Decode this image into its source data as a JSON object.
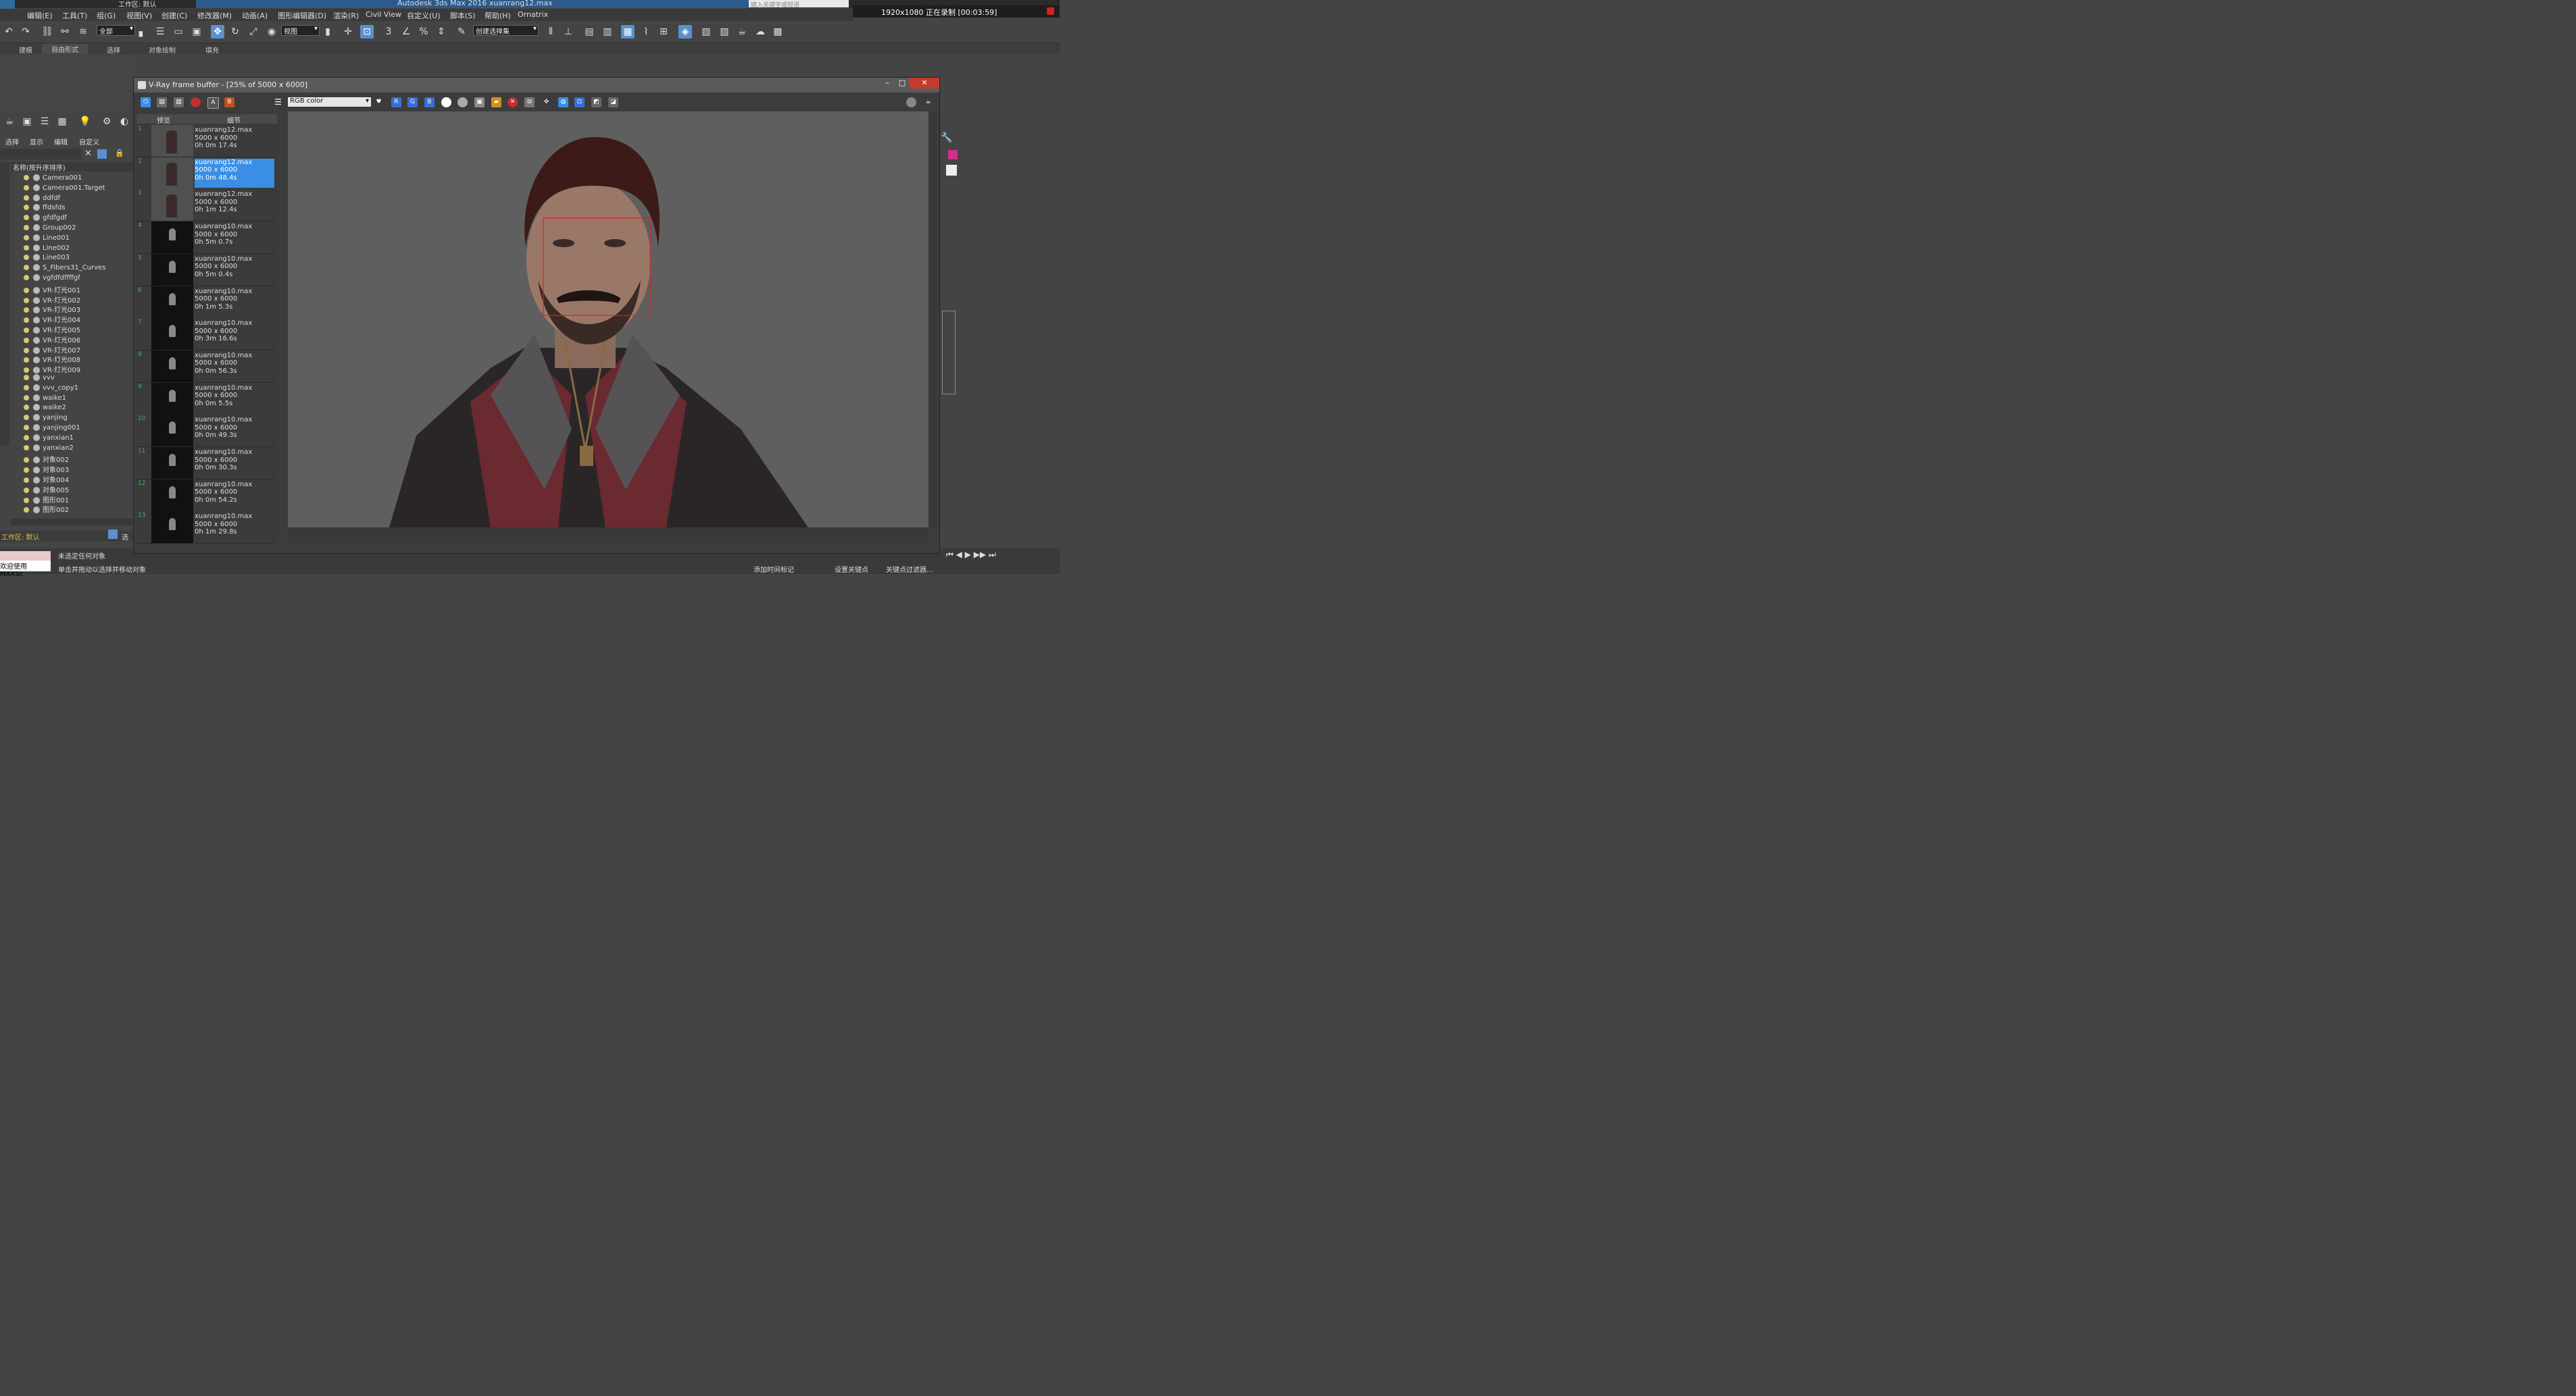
{
  "app": {
    "title": "Autodesk 3ds Max 2016    xuanrang12.max",
    "workspace": "工作区: 默认",
    "search_placeholder": "键入关键字或短语",
    "recording": "1920x1080  正在录制 [00:03:59]"
  },
  "menu": [
    "编辑(E)",
    "工具(T)",
    "组(G)",
    "视图(V)",
    "创建(C)",
    "修改器(M)",
    "动画(A)",
    "图形编辑器(D)",
    "渲染(R)",
    "Civil View",
    "自定义(U)",
    "脚本(S)",
    "帮助(H)",
    "Ornatrix"
  ],
  "toolbar": {
    "selection_filter": "全部",
    "ref_coord": "视图",
    "named_set": "创建选择集"
  },
  "ribbon_tabs": [
    "建模",
    "自由形式",
    "选择",
    "对象绘制",
    "填充"
  ],
  "explorer": {
    "tabs": [
      "选择",
      "显示",
      "编辑",
      "自定义"
    ],
    "header": "名称(按升序排序)",
    "items": [
      "Camera001",
      "Camera001.Target",
      "ddfdf",
      "ffdsfds",
      "gfdfgdf",
      "Group002",
      "Line001",
      "Line002",
      "Line003",
      "S_Fibers31_Curves",
      "vgfdfdffffgf",
      "VR-灯光001",
      "VR-灯光002",
      "VR-灯光003",
      "VR-灯光004",
      "VR-灯光005",
      "VR-灯光006",
      "VR-灯光007",
      "VR-灯光008",
      "VR-灯光009",
      "vvv",
      "vvv_copy1",
      "waike1",
      "waike2",
      "yanjing",
      "yanjing001",
      "yanxian1",
      "yanxian2",
      "对象002",
      "对象003",
      "对象004",
      "对象005",
      "图形001",
      "图形002"
    ],
    "workspace": "工作区: 默认",
    "select_label": "选"
  },
  "status": {
    "maxscript": "欢迎使用 MAXSc",
    "line1": "未选定任何对象",
    "line2": "单击并拖动以选择并移动对象",
    "add_time_tag": "添加时间标记",
    "set_key": "设置关键点",
    "key_filter": "关键点过滤器..."
  },
  "vfb": {
    "title": "V-Ray frame buffer - [25% of 5000 x 6000]",
    "channel": "RGB color",
    "history_headers": [
      "预览",
      "细节"
    ],
    "history": [
      {
        "num": "1",
        "file": "xuanrang12.max",
        "res": "5000 x 6000",
        "time": "0h 0m 17.4s",
        "thumb": "person"
      },
      {
        "num": "2",
        "file": "xuanrang12.max",
        "res": "5000 x 6000",
        "time": "0h 0m 48.4s",
        "thumb": "person",
        "selected": true
      },
      {
        "num": "3",
        "file": "xuanrang12.max",
        "res": "5000 x 6000",
        "time": "0h 1m 12.4s",
        "thumb": "person"
      },
      {
        "num": "4",
        "file": "xuanrang10.max",
        "res": "5000 x 6000",
        "time": "0h 5m 0.7s",
        "thumb": "dark"
      },
      {
        "num": "5",
        "file": "xuanrang10.max",
        "res": "5000 x 6000",
        "time": "0h 5m 0.4s",
        "thumb": "dark"
      },
      {
        "num": "6",
        "file": "xuanrang10.max",
        "res": "5000 x 6000",
        "time": "0h 1m 5.3s",
        "thumb": "dark"
      },
      {
        "num": "7",
        "file": "xuanrang10.max",
        "res": "5000 x 6000",
        "time": "0h 3m 16.6s",
        "thumb": "dark"
      },
      {
        "num": "8",
        "file": "xuanrang10.max",
        "res": "5000 x 6000",
        "time": "0h 0m 56.3s",
        "thumb": "dark"
      },
      {
        "num": "9",
        "file": "xuanrang10.max",
        "res": "5000 x 6000",
        "time": "0h 0m 5.5s",
        "thumb": "dark"
      },
      {
        "num": "10",
        "file": "xuanrang10.max",
        "res": "5000 x 6000",
        "time": "0h 0m 49.3s",
        "thumb": "dark"
      },
      {
        "num": "11",
        "file": "xuanrang10.max",
        "res": "5000 x 6000",
        "time": "0h 0m 30.3s",
        "thumb": "dark"
      },
      {
        "num": "12",
        "file": "xuanrang10.max",
        "res": "5000 x 6000",
        "time": "0h 0m 54.2s",
        "thumb": "dark"
      },
      {
        "num": "13",
        "file": "xuanrang10.max",
        "res": "5000 x 6000",
        "time": "0h 1m 29.8s",
        "thumb": "dark"
      }
    ],
    "accent": "#3a8ee6",
    "region_color": "#e02020"
  }
}
